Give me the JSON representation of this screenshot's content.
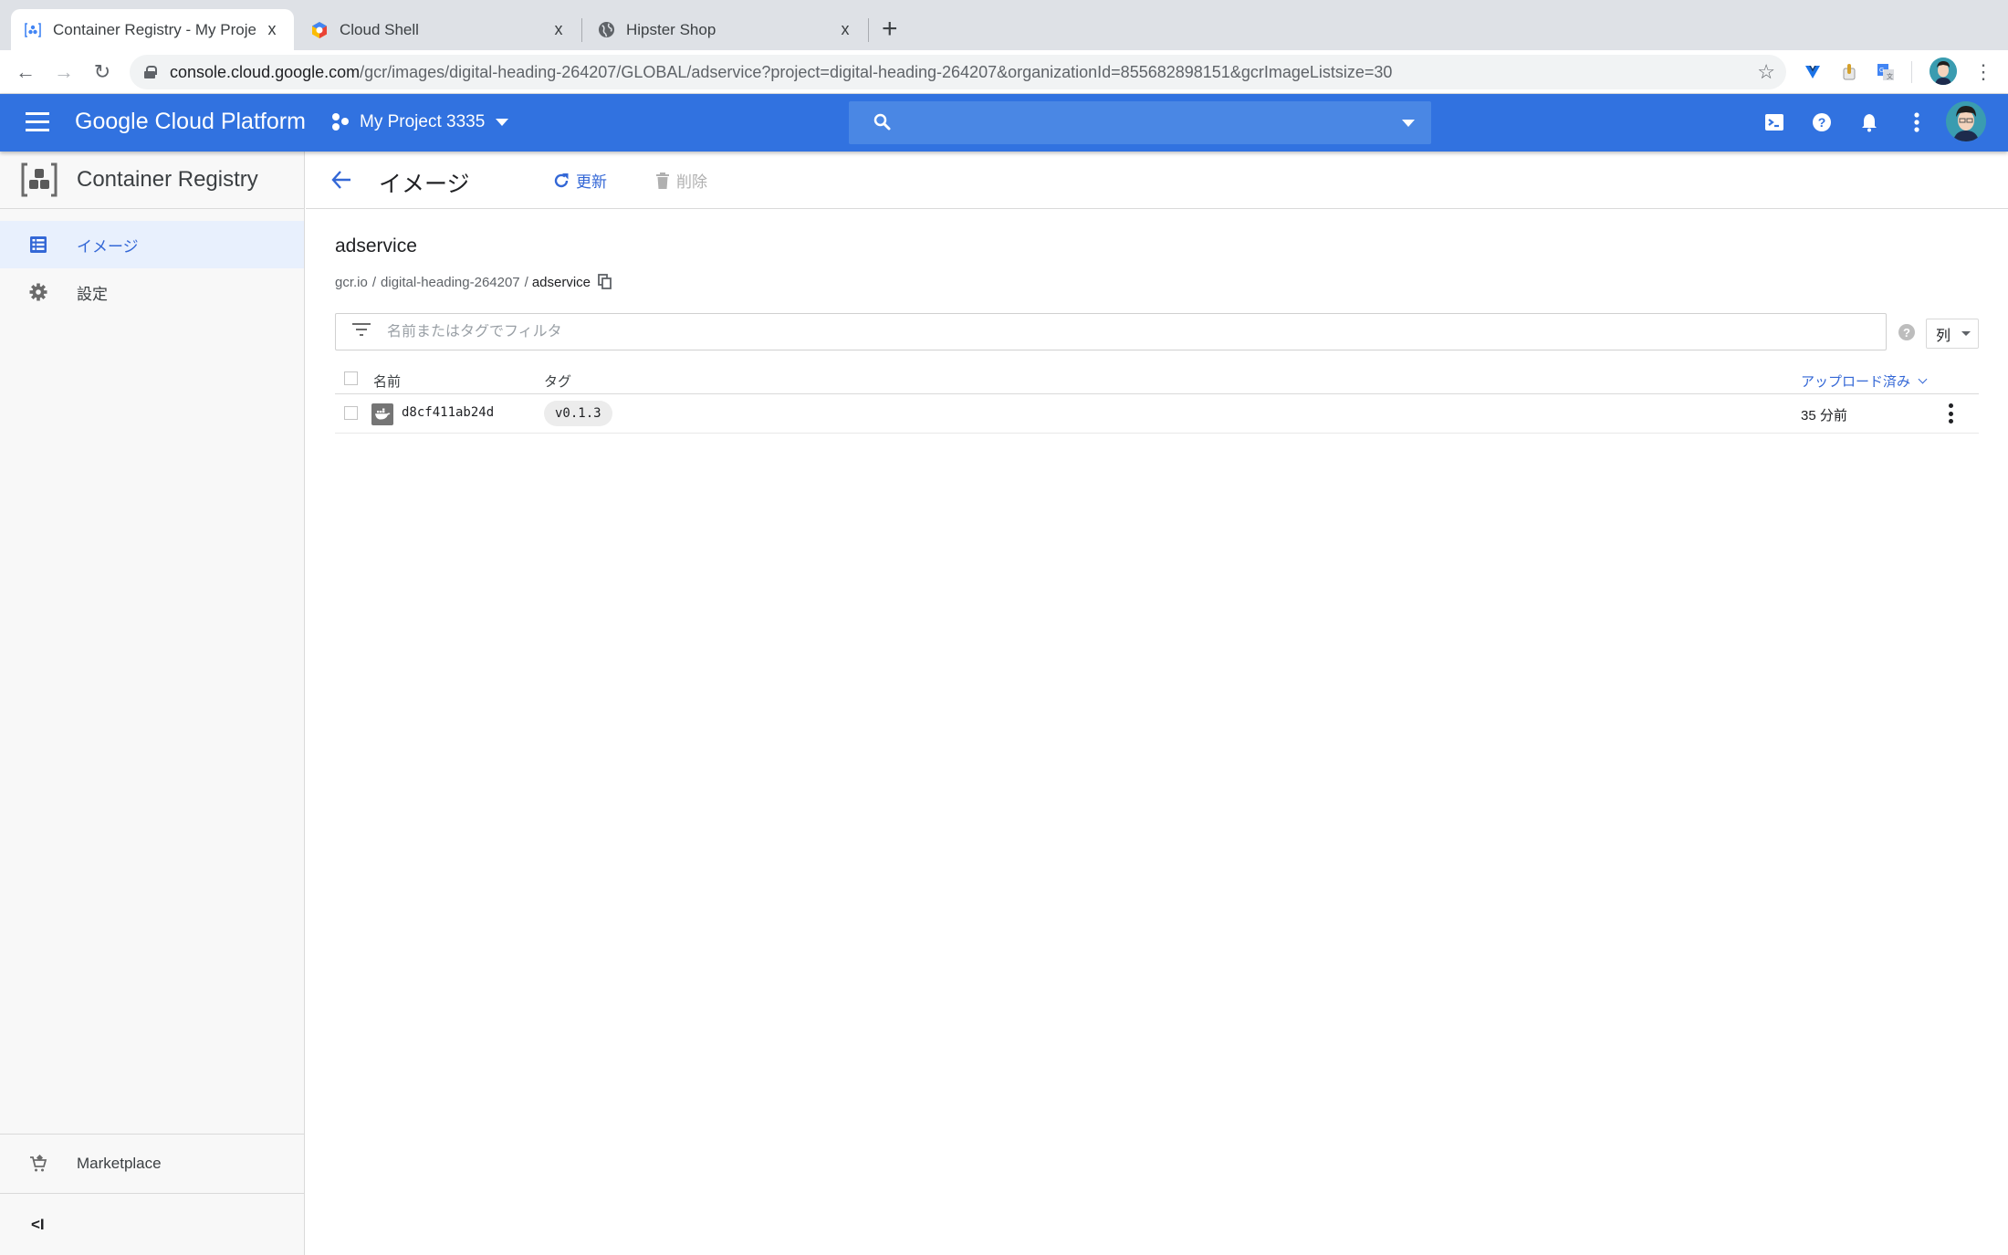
{
  "browser": {
    "tabs": [
      {
        "title": "Container Registry - My Project",
        "icon": "container-registry-icon",
        "active": true
      },
      {
        "title": "Cloud Shell",
        "icon": "cloud-shell-icon",
        "active": false
      },
      {
        "title": "Hipster Shop",
        "icon": "globe-icon",
        "active": false
      }
    ],
    "close_glyph": "x",
    "new_tab_glyph": "+",
    "url_host": "console.cloud.google.com",
    "url_path": "/gcr/images/digital-heading-264207/GLOBAL/adservice?project=digital-heading-264207&organizationId=855682898151&gcrImageListsize=30",
    "nav": {
      "back": "←",
      "forward": "→",
      "reload": "↻"
    },
    "star_glyph": "☆",
    "menu_glyph": "⋮"
  },
  "header": {
    "brand": "Google Cloud Platform",
    "project": "My Project 3335",
    "search_placeholder": "",
    "colors": {
      "primary": "#3172e0",
      "search_bg": "#4a87e4"
    }
  },
  "sidebar": {
    "product": "Container Registry",
    "items": [
      {
        "label": "イメージ",
        "icon": "list-icon",
        "active": true
      },
      {
        "label": "設定",
        "icon": "gear-icon",
        "active": false
      }
    ],
    "marketplace": "Marketplace",
    "collapse_glyph": "<I"
  },
  "page": {
    "title": "イメージ",
    "actions": {
      "refresh": "更新",
      "delete": "削除"
    },
    "repo_name": "adservice",
    "path": {
      "registry": "gcr.io",
      "project": "digital-heading-264207",
      "repo": "adservice",
      "separator": "/"
    },
    "filter_placeholder": "名前またはタグでフィルタ",
    "help_glyph": "?",
    "columns_button": "列",
    "table": {
      "headers": {
        "name": "名前",
        "tags": "タグ",
        "uploaded": "アップロード済み"
      },
      "rows": [
        {
          "name": "d8cf411ab24d",
          "tag": "v0.1.3",
          "uploaded": "35 分前"
        }
      ]
    },
    "accent": "#3367d6"
  }
}
